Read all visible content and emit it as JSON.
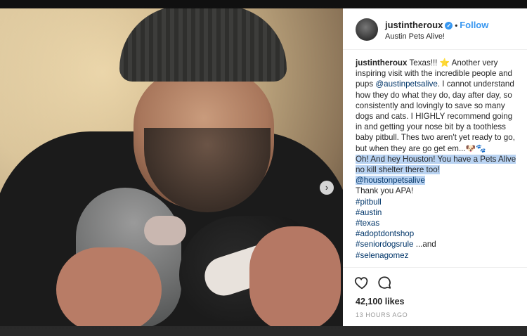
{
  "post": {
    "username": "justintheroux",
    "follow_label": "Follow",
    "separator": "•",
    "location": "Austin Pets Alive!",
    "next_arrow": "›",
    "caption": {
      "username": "justintheroux",
      "p1": " Texas!!! ⭐ Another very inspiring visit with the incredible people and pups ",
      "mention1": "@austinpetsalive",
      "p2": ". I cannot understand how they do what they do, day after day, so consistently and lovingly to save so many dogs and cats. I HIGHLY recommend going in and getting your nose bit by a toothless baby pitbull. Thes two aren't yet ready to go, but when they are go get em...🐶🐾",
      "highlight": "Oh! And hey Houston! You have a Pets Alive no kill shelter there too!",
      "mention2": "@houstonpetsalive",
      "p3": "Thank you APA!",
      "hashtags": [
        "#pitbull",
        "#austin",
        "#texas",
        "#adoptdontshop",
        "#seniordogsrule"
      ],
      "hashtag_suffix": " ...and",
      "last_hashtag": "#selenagomez"
    },
    "likes": "42,100 likes",
    "timestamp": "13 HOURS AGO"
  },
  "icons": {
    "verified": "verified-badge-icon",
    "heart": "heart-icon",
    "comment": "comment-icon",
    "next": "chevron-right-icon"
  },
  "colors": {
    "accent": "#3897f0",
    "highlight": "#b9d3f2",
    "text": "#262626",
    "muted": "#999999"
  }
}
